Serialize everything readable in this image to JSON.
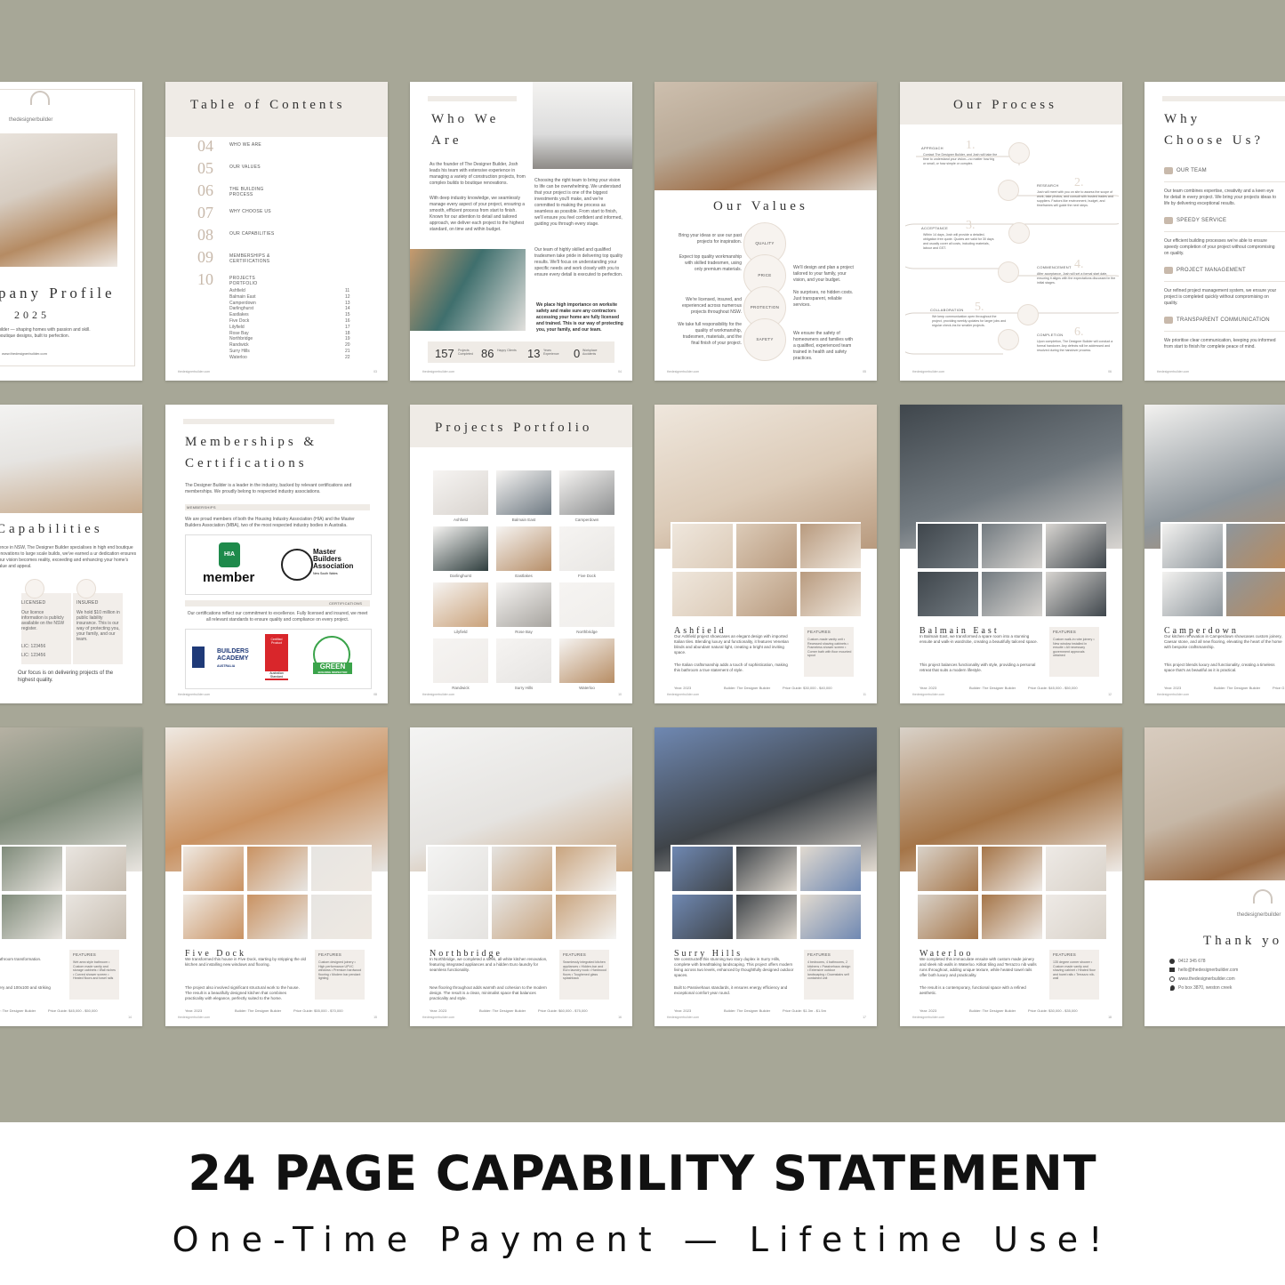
{
  "banner": {
    "title": "24 PAGE CAPABILITY STATEMENT",
    "subtitle": "One-Time Payment — Lifetime Use!"
  },
  "cover": {
    "brand": "thedesignerbuilder",
    "title": "pany Profile",
    "year": "2025",
    "blurb": "uilder — shaping homes with passion and skill.\nboutique designs, built to perfection.",
    "url": "www.thedesignerbuilder.com"
  },
  "toc": {
    "title": "Table of Contents",
    "items": [
      {
        "n": "04",
        "label": "WHO WE ARE"
      },
      {
        "n": "05",
        "label": "OUR VALUES"
      },
      {
        "n": "06",
        "label": "THE BUILDING PROCESS"
      },
      {
        "n": "07",
        "label": "WHY CHOOSE US"
      },
      {
        "n": "08",
        "label": "OUR CAPABILITIES"
      },
      {
        "n": "09",
        "label": "MEMBERSHIPS & CERTIFICATIONS"
      },
      {
        "n": "10",
        "label": "PROJECTS PORTFOLIO"
      }
    ],
    "projects": [
      [
        "Ashfield",
        "11"
      ],
      [
        "Balmain East",
        "12"
      ],
      [
        "Camperdown",
        "13"
      ],
      [
        "Darlinghurst",
        "14"
      ],
      [
        "Eastlakes",
        "15"
      ],
      [
        "Five Dock",
        "16"
      ],
      [
        "Lilyfield",
        "17"
      ],
      [
        "Rose Bay",
        "18"
      ],
      [
        "Northbridge",
        "19"
      ],
      [
        "Randwick",
        "20"
      ],
      [
        "Surry Hills",
        "21"
      ],
      [
        "Waterloo",
        "22"
      ]
    ]
  },
  "who": {
    "title1": "Who We",
    "title2": "Are",
    "p1": "As the founder of The Designer Builder, Josh leads his team with extensive experience in managing a variety of construction projects, from complex builds to boutique renovations.",
    "p2": "With deep industry knowledge, we seamlessly manage every aspect of your project, ensuring a smooth, efficient process from start to finish. Known for our attention to detail and tailored approach, we deliver each project to the highest standard, on time and within budget.",
    "p3": "Choosing the right team to bring your vision to life can be overwhelming. We understand that your project is one of the biggest investments you'll make, and we're committed to making the process as seamless as possible. From start to finish, we'll ensure you feel confident and informed, guiding you through every stage.",
    "p4": "Our team of highly skilled and qualified tradesmen take pride in delivering top quality results. We'll focus on understanding your specific needs and work closely with you to ensure every detail is executed to perfection.",
    "p5": "We place high importance on worksite safety and make sure any contractors accessing your home are fully licensed and trained. This is our way of protecting you, your family, and our team.",
    "stats": [
      [
        "157",
        "Projects Completed"
      ],
      [
        "86",
        "Happy Clients"
      ],
      [
        "13",
        "Years Experience"
      ],
      [
        "0",
        "Workplace Accidents"
      ]
    ]
  },
  "values": {
    "title": "Our Values",
    "items": [
      "QUALITY",
      "PRICE",
      "PROTECTION",
      "SAFETY"
    ],
    "left": [
      "Bring your ideas or use our past projects for inspiration.",
      "Expect top quality workmanship with skilled tradesmen, using only premium materials.",
      "We're licensed, insured, and experienced across numerous projects throughout NSW.",
      "We take full responsibility for the quality of workmanship, tradesmen, materials, and the final finish of your project."
    ],
    "right": [
      "We'll design and plan a project tailored to your family, your vision, and your budget.",
      "No surprises, no hidden costs. Just transparent, reliable services.",
      "We ensure the safety of homeowners and families with a qualified, experienced team trained in health and safety practices."
    ]
  },
  "process": {
    "title": "Our Process",
    "steps": [
      [
        "APPROACH",
        "1."
      ],
      [
        "RESEARCH",
        "2."
      ],
      [
        "ACCEPTANCE",
        "3."
      ],
      [
        "COMMENCEMENT",
        "4."
      ],
      [
        "COLLABORATION",
        "5."
      ],
      [
        "COMPLETION",
        "6."
      ]
    ],
    "t1": "Contact The Designer Builder, and Josh will take the time to understand your vision—no matter how big or small, or how simple or complex.",
    "t2": "Josh will meet with you on site to assess the scope of work, take photos, and consult with trusted trades and suppliers. Factors like environment, budget, and timeframes will guide the next steps.",
    "t3": "Within 14 days, Josh will provide a detailed, obligation free quote. Quotes are valid for 30 days and usually cover all costs, including materials, labour and GST.",
    "t4": "After acceptance, Josh will set a formal start date, ensuring it aligns with the expectations discussed in the initial stages.",
    "t5": "We keep communication open throughout the project, providing weekly updates for larger jobs and regular check-ins for smaller projects.",
    "t6": "Upon completion, The Designer Builder will conduct a formal handover. Any defects will be addressed and resolved during the handover process."
  },
  "why": {
    "title1": "Why",
    "title2": "Choose Us?",
    "items": [
      [
        "OUR TEAM",
        "Our team combines expertise, creativity and a keen eye for detail in every project. We bring your projects ideas to life by delivering exceptional results."
      ],
      [
        "SPEEDY SERVICE",
        "Our efficient building processes we're able to ensure speedy completion of your project without compromising on quality."
      ],
      [
        "PROJECT MANAGEMENT",
        "Our refined project management system, we ensure your project is completed quickly without compromising on quality."
      ],
      [
        "TRANSPARENT COMMUNICATION",
        "We prioritise clear communication, keeping you informed from start to finish for complete peace of mind."
      ]
    ]
  },
  "caps": {
    "title": "Capabilities",
    "p1": "rience in NSW, The Designer Builder specialises in high end boutique renovations to large scale builds, we've earned a ur dedication ensures your vision becomes reality, exceeding and enhancing your home's value and appeal.",
    "licensed": "LICENSED",
    "lic_text": "Our licence information is publicly available on the NSW register.",
    "lic1": "LIC: 123456",
    "lic2": "LIC: 123456",
    "insured": "INSURED",
    "ins_text": "We hold $10 million in public liability insurance. This is our way of protecting you, your family, and our team.",
    "focus": "Our focus is on delivering projects of the highest quality."
  },
  "members": {
    "title1": "Memberships &",
    "title2": "Certifications",
    "intro": "The Designer Builder is a leader in the industry, backed by relevant certifications and memberships. We proudly belong to respected industry associations.",
    "label1": "MEMBERSHIPS",
    "p1": "We are proud members of both the Housing Industry Association (HIA) and the Master Builders Association (MBA), two of the most respected industry bodies in Australia.",
    "hia": "HIA",
    "hia_member": "member",
    "mba1": "Master",
    "mba2": "Builders",
    "mba3": "Association",
    "mba4": "New South Wales",
    "label2": "CERTIFICATIONS",
    "p2": "Our certifications reflect our commitment to excellence. Fully licensed and insured, we meet all relevant standards to ensure quality and compliance on every project.",
    "ba1": "BUILDERS",
    "ba2": "ACADEMY",
    "ba3": "AUSTRALIA",
    "as1": "Certified Product",
    "as2": "Australian Standard",
    "green1": "GREEN",
    "green2": "BUILDING INSPECTOR"
  },
  "portfolio": {
    "title": "Projects Portfolio",
    "items": [
      "Ashfield",
      "Balmain East",
      "Camperdown",
      "Darlinghurst",
      "Eastlakes",
      "Five Dock",
      "Lilyfield",
      "Rose Bay",
      "Northbridge",
      "Randwick",
      "Surry Hills",
      "Waterloo"
    ]
  },
  "projects": [
    {
      "name": "Ashfield",
      "text": "Our Ashfield project showcases an elegant design with imported Italian tiles. Blending luxury and functionality, it features Venetian blinds and abundant natural light, creating a bright and inviting space.",
      "text2": "The Italian craftsmanship adds a touch of sophistication, making this bathroom a true statement of style.",
      "features": "Custom-made vanity unit • Recessed shaving cabinets • Frameless shower screen • Corner bath with floor mounted spout",
      "year": "Year: 2023",
      "builder": "Builder: The Designer Builder",
      "price": "Price Guide: $30,000 - $40,000"
    },
    {
      "name": "Balmain East",
      "text": "In Balmain East, we transformed a spare room into a stunning ensuite and walk-in wardrobe, creating a beautifully tailored space.",
      "text2": "This project balances functionality with style, providing a personal retreat that suits a modern lifestyle.",
      "features": "Custom walk-in robe joinery • New window installed in ensuite • All necessary government approvals obtained",
      "year": "Year: 2023",
      "builder": "Builder: The Designer Builder",
      "price": "Price Guide: $45,000 - $50,000"
    },
    {
      "name": "Camperdown",
      "text": "Our kitchen renovation in Camperdown showcases custom joinery, Caesar stone, and all new flooring, elevating the heart of the home with bespoke craftsmanship.",
      "text2": "This project blends luxury and functionality, creating a timeless space that's as beautiful as it is practical.",
      "year": "Year: 2023",
      "builder": "Builder: The Designer Builder",
      "price": "Price G"
    },
    {
      "name": "",
      "text": "terior designer to bring their red bathroom transformation.",
      "text2": "s functionality and style mady joinery and 100x100 and striking finish.",
      "features": "Wet area style bathroom • Custom made vanity and storage cabinets • Wall niches • Curved shower screen • Heated floors and towel rails",
      "year": "",
      "builder": "Builder: The Designer Builder",
      "price": "Price Guide: $45,000 - $50,000"
    },
    {
      "name": "Five Dock",
      "text": "We transformed this house in Five Dock, starting by stripping the old kitchen and installing new windows and flooring.",
      "text2": "The project also involved significant structural work to the house. The result is a beautifully designed kitchen that combines practicality with elegance, perfectly suited to the home.",
      "features": "Custom designed joinery • High performance UPVC windows • Premium hardwood flooring • Modern bar pendant lighting",
      "year": "Year: 2023",
      "builder": "Builder: The Designer Builder",
      "price": "Price Guide: $55,000 - $70,000"
    },
    {
      "name": "Northbridge",
      "text": "In Northbridge, we completed a sleek, all-white kitchen renovation, featuring integrated appliances and a hidden Euro laundry for seamless functionality.",
      "text2": "New flooring throughout adds warmth and cohesion to the modern design. The result is a clean, minimalist space that balances practicality and style.",
      "features": "Seamlessly integrated kitchen appliances • Hidden-bar and Euro laundry nook • Hardwood floors • Toughened glass splashback",
      "year": "Year: 2023",
      "builder": "Builder: The Designer Builder",
      "price": "Price Guide: $60,000 - $75,000"
    },
    {
      "name": "Surry Hills",
      "text": "We constructed this stunning two story duplex in Surry Hills, complete with breathtaking landscaping. This project offers modern living across two levels, enhanced by thoughtfully designed outdoor spaces.",
      "text2": "Built to Passivehaus standards, it ensures energy efficiency and exceptional comfort year round.",
      "features": "4 bedrooms, 4 bathrooms, 2 kitchens • Passivehaus design • Extensive outdoor landscaping • Downstairs self contained unit",
      "year": "Year: 2023",
      "builder": "Builder: The Designer Builder",
      "price": "Price Guide: $1.3m - $1.5m"
    },
    {
      "name": "Waterloo",
      "text": "We completed this immaculate ensuite with custom made joinery and sleek nib walls in Waterloo. Kitkat tiling and Terrazzo nib walls runs throughout, adding unique texture, while heated towel rails offer both luxury and practicality.",
      "text2": "The result is a contemporary, functional space with a refined aesthetic.",
      "features": "135 degree corner shower • Custom made vanity and shaving cabinet • Heated floor and towel rails • Terrazzo nib-wall",
      "year": "Year: 2023",
      "builder": "Builder: The Designer Builder",
      "price": "Price Guide: $30,000 - $35,000"
    }
  ],
  "featuresLabel": "FEATURES",
  "thanks": {
    "brand": "thedesignerbuilder",
    "title": "Thank yo",
    "phone": "0412 345 678",
    "email": "hello@thedesignerbuilder.com",
    "web": "www.thedesignerbuilder.com",
    "po": "Po box 3870, weston creek"
  },
  "footer": "thedesignerbuilder.com",
  "pages": [
    "03",
    "04",
    "05",
    "06",
    "07",
    "08",
    "09",
    "10",
    "11",
    "12",
    "13",
    "14",
    "15",
    "16",
    "17",
    "18",
    "19",
    "20"
  ]
}
